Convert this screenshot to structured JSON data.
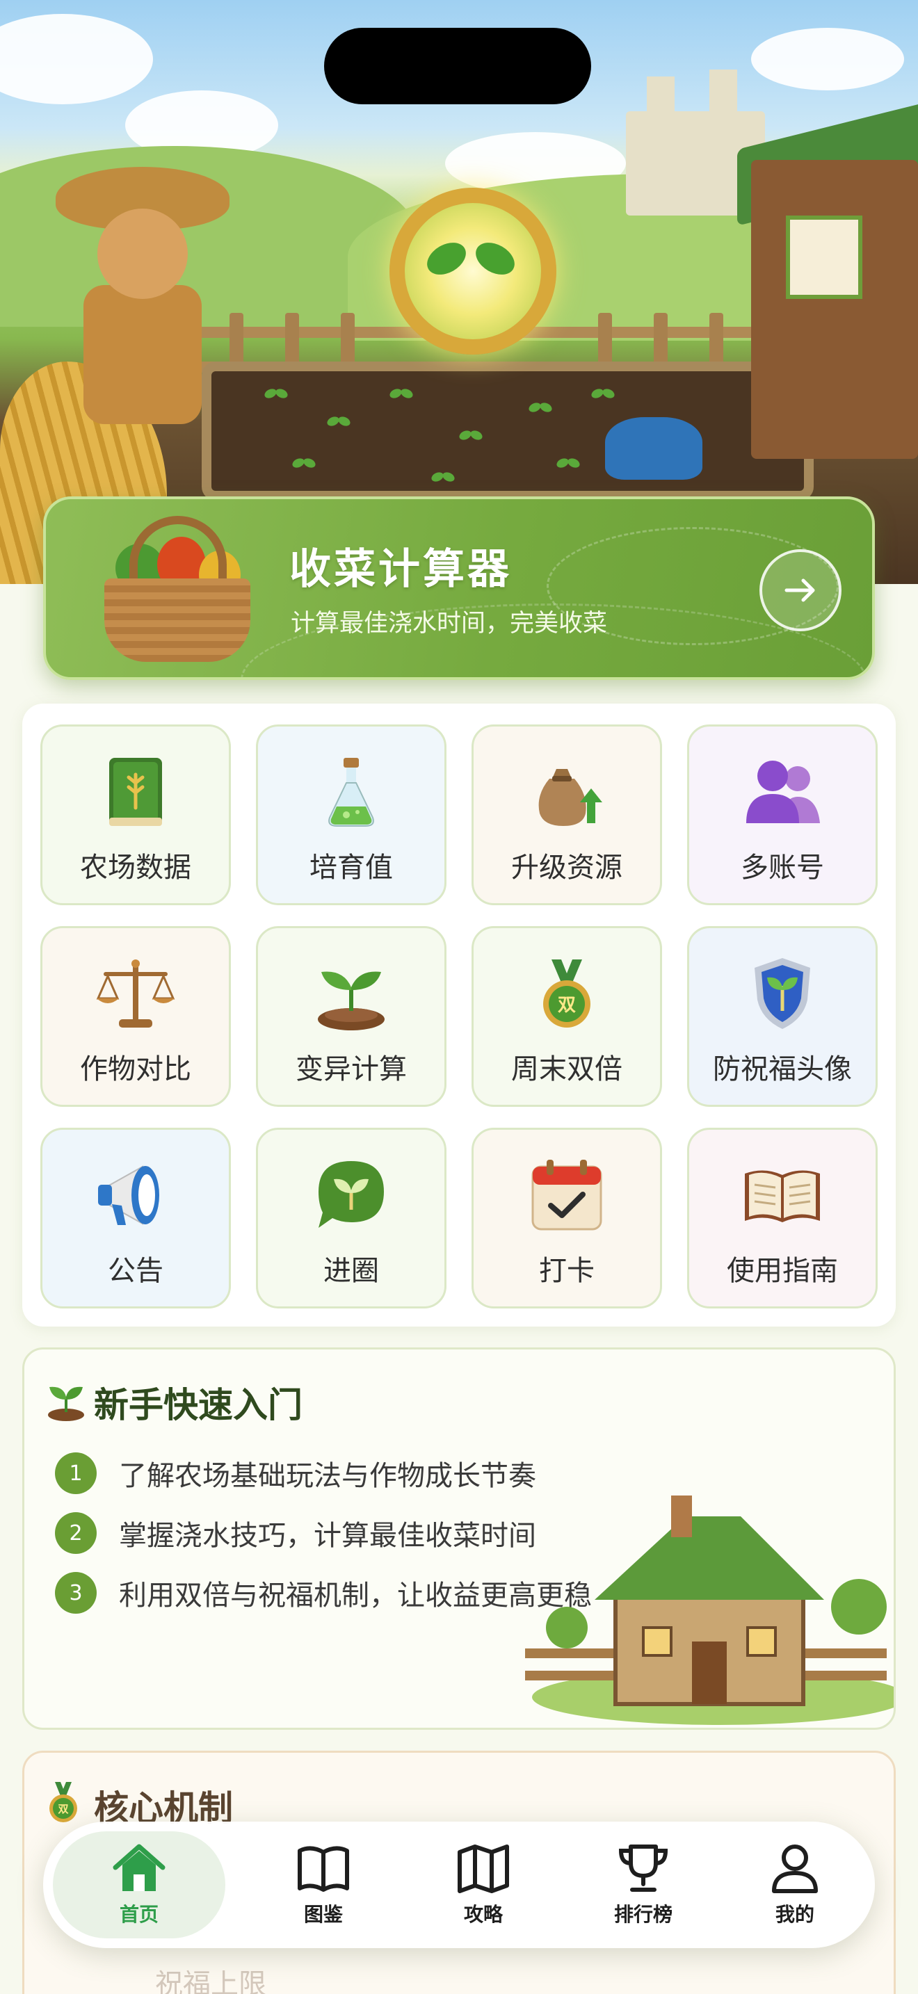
{
  "banner": {
    "title": "收菜计算器",
    "subtitle": "计算最佳浇水时间，完美收菜"
  },
  "grid": [
    {
      "label": "农场数据",
      "icon": "farm-book-icon"
    },
    {
      "label": "培育值",
      "icon": "potion-flask-icon"
    },
    {
      "label": "升级资源",
      "icon": "money-bag-up-icon"
    },
    {
      "label": "多账号",
      "icon": "users-icon"
    },
    {
      "label": "作物对比",
      "icon": "balance-scale-icon"
    },
    {
      "label": "变异计算",
      "icon": "sprout-soil-icon"
    },
    {
      "label": "周末双倍",
      "icon": "double-medal-icon"
    },
    {
      "label": "防祝福头像",
      "icon": "shield-leaf-icon"
    },
    {
      "label": "公告",
      "icon": "megaphone-icon"
    },
    {
      "label": "进圈",
      "icon": "chat-leaf-icon"
    },
    {
      "label": "打卡",
      "icon": "calendar-check-icon"
    },
    {
      "label": "使用指南",
      "icon": "open-book-icon"
    }
  ],
  "newbie": {
    "title": "新手快速入门",
    "steps": [
      {
        "num": "1",
        "text": "了解农场基础玩法与作物成长节奏"
      },
      {
        "num": "2",
        "text": "掌握浇水技巧，计算最佳收菜时间"
      },
      {
        "num": "3",
        "text": "利用双倍与祝福机制，让收益更高更稳"
      }
    ]
  },
  "core": {
    "title": "核心机制",
    "faded_item": "祝福上限"
  },
  "nav": [
    {
      "label": "首页",
      "icon": "home-icon",
      "active": true
    },
    {
      "label": "图鉴",
      "icon": "book-icon",
      "active": false
    },
    {
      "label": "攻略",
      "icon": "map-icon",
      "active": false
    },
    {
      "label": "排行榜",
      "icon": "trophy-icon",
      "active": false
    },
    {
      "label": "我的",
      "icon": "user-icon",
      "active": false
    }
  ],
  "colors": {
    "accent_green": "#76aa3f",
    "nav_active": "#2e9e4a"
  }
}
